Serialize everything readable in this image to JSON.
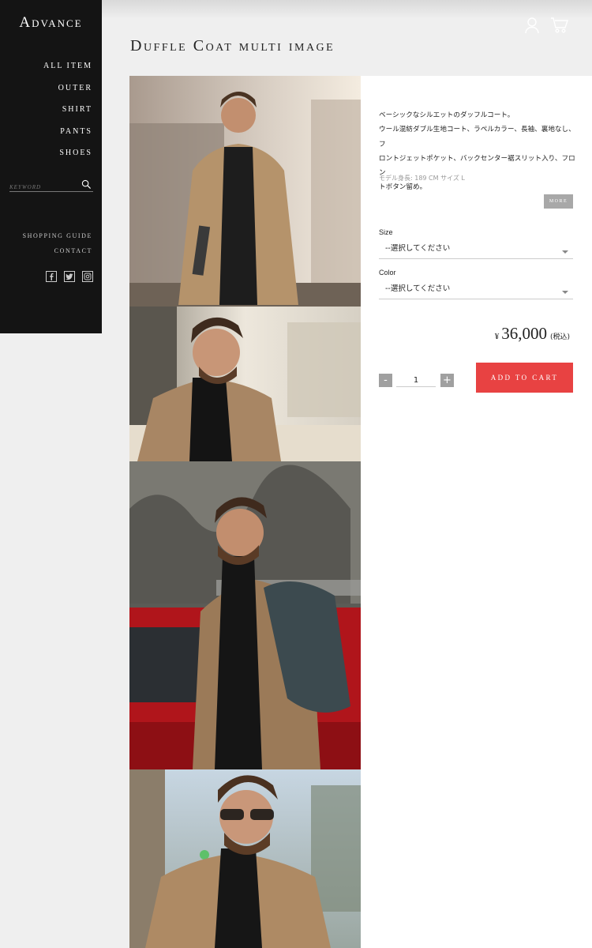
{
  "brand": {
    "logo": "Advance"
  },
  "nav": {
    "items": [
      "ALL ITEM",
      "OUTER",
      "SHIRT",
      "PANTS",
      "SHOES"
    ],
    "search_placeholder": "KEYWORD",
    "guide": "SHOPPING GUIDE",
    "contact": "CONTACT",
    "social_icons": [
      "facebook-icon",
      "twitter-icon",
      "instagram-icon"
    ]
  },
  "header": {
    "icons": [
      "user-icon",
      "cart-icon"
    ]
  },
  "product": {
    "title": "Duffle Coat multi image",
    "description_lines": [
      "ベーシックなシルエットのダッフルコート。",
      "ウール混紡ダブル生地コート、ラペルカラー、長袖、裏地なし、フ",
      "ロントジェットポケット、バックセンター裾スリット入り、フロン",
      "トボタン留め。"
    ],
    "model_info": "モデル身長: 189 CM サイズ L",
    "more_label": "MORE",
    "size_label": "Size",
    "size_value": "--選択してください",
    "color_label": "Color",
    "color_value": "--選択してください",
    "currency": "¥",
    "price": "36,000",
    "tax_note": "(税込)",
    "quantity": "1",
    "minus": "-",
    "plus": "+",
    "add_to_cart": "ADD TO CART"
  },
  "colors": {
    "sidebar": "#141414",
    "accent": "#e84242",
    "background": "#efefef"
  }
}
